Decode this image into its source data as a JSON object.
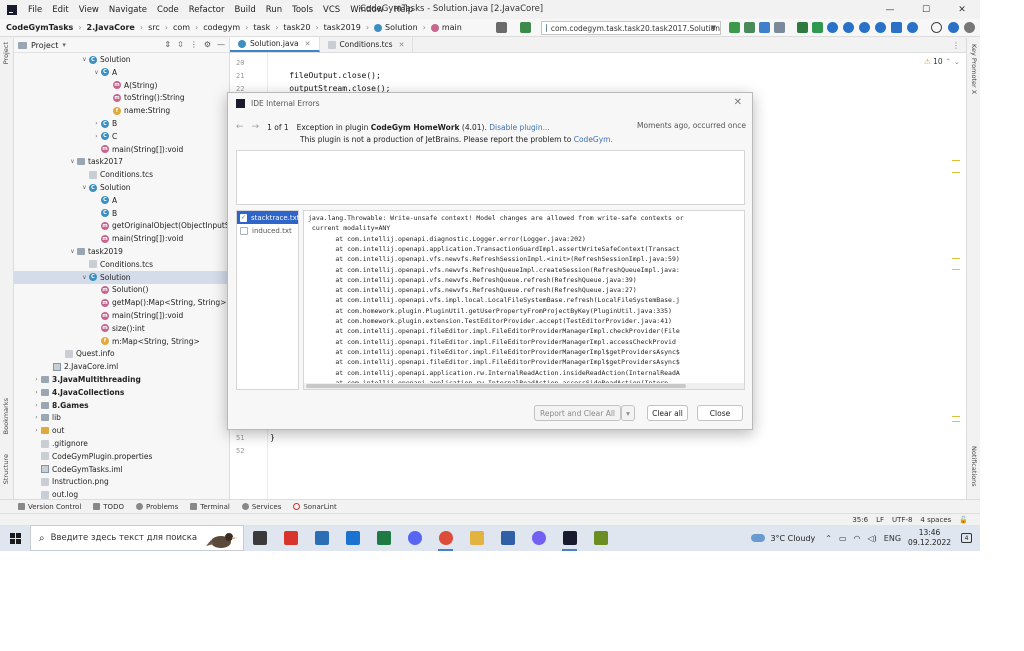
{
  "window": {
    "title": "CodeGymTasks - Solution.java [2.JavaCore]",
    "menu": [
      "File",
      "Edit",
      "View",
      "Navigate",
      "Code",
      "Refactor",
      "Build",
      "Run",
      "Tools",
      "VCS",
      "Window",
      "Help"
    ],
    "controls": [
      "—",
      "☐",
      "✕"
    ]
  },
  "breadcrumbs": [
    "CodeGymTasks",
    "2.JavaCore",
    "src",
    "com",
    "codegym",
    "task",
    "task20",
    "task2019",
    "Solution",
    "main"
  ],
  "run_config": "com.codegym.task.task20.task2017.Solution",
  "project_panel": {
    "title": "Project",
    "tree": [
      {
        "label": "Solution",
        "icon": "class",
        "arrow": "▾",
        "indent": 6
      },
      {
        "label": "A",
        "icon": "class",
        "arrow": "▾",
        "indent": 7
      },
      {
        "label": "A(String)",
        "icon": "method",
        "arrow": "",
        "indent": 8
      },
      {
        "label": "toString():String",
        "icon": "method",
        "arrow": "",
        "indent": 8
      },
      {
        "label": "name:String",
        "icon": "field",
        "arrow": "",
        "indent": 8
      },
      {
        "label": "B",
        "icon": "class",
        "arrow": "▸",
        "indent": 7
      },
      {
        "label": "C",
        "icon": "class",
        "arrow": "▸",
        "indent": 7
      },
      {
        "label": "main(String[]):void",
        "icon": "method",
        "arrow": "",
        "indent": 7
      },
      {
        "label": "task2017",
        "icon": "folder",
        "arrow": "▾",
        "indent": 5
      },
      {
        "label": "Conditions.tcs",
        "icon": "file",
        "arrow": "",
        "indent": 6
      },
      {
        "label": "Solution",
        "icon": "class",
        "arrow": "▾",
        "indent": 6
      },
      {
        "label": "A",
        "icon": "class",
        "arrow": "",
        "indent": 7
      },
      {
        "label": "B",
        "icon": "class",
        "arrow": "",
        "indent": 7
      },
      {
        "label": "getOriginalObject(ObjectInputS",
        "icon": "method",
        "arrow": "",
        "indent": 7
      },
      {
        "label": "main(String[]):void",
        "icon": "method",
        "arrow": "",
        "indent": 7
      },
      {
        "label": "task2019",
        "icon": "folder",
        "arrow": "▾",
        "indent": 5
      },
      {
        "label": "Conditions.tcs",
        "icon": "file",
        "arrow": "",
        "indent": 6
      },
      {
        "label": "Solution",
        "icon": "class",
        "arrow": "▾",
        "indent": 6,
        "selected": true
      },
      {
        "label": "Solution()",
        "icon": "method",
        "arrow": "",
        "indent": 7
      },
      {
        "label": "getMap():Map<String, String>",
        "icon": "method",
        "arrow": "",
        "indent": 7
      },
      {
        "label": "main(String[]):void",
        "icon": "method",
        "arrow": "",
        "indent": 7
      },
      {
        "label": "size():int",
        "icon": "method",
        "arrow": "",
        "indent": 7
      },
      {
        "label": "m:Map<String, String>",
        "icon": "field",
        "arrow": "",
        "indent": 7
      },
      {
        "label": "Quest.info",
        "icon": "file",
        "arrow": "",
        "indent": 4
      },
      {
        "label": "2.JavaCore.iml",
        "icon": "iml",
        "arrow": "",
        "indent": 3
      },
      {
        "label": "3.JavaMultithreading",
        "icon": "folder",
        "arrow": "▸",
        "indent": 2,
        "bold": true
      },
      {
        "label": "4.JavaCollections",
        "icon": "folder",
        "arrow": "▸",
        "indent": 2,
        "bold": true
      },
      {
        "label": "8.Games",
        "icon": "folder",
        "arrow": "▸",
        "indent": 2,
        "bold": true
      },
      {
        "label": "lib",
        "icon": "folder",
        "arrow": "▸",
        "indent": 2
      },
      {
        "label": "out",
        "icon": "folder-orange",
        "arrow": "▸",
        "indent": 2
      },
      {
        "label": ".gitignore",
        "icon": "file",
        "arrow": "",
        "indent": 2
      },
      {
        "label": "CodeGymPlugin.properties",
        "icon": "file",
        "arrow": "",
        "indent": 2
      },
      {
        "label": "CodeGymTasks.iml",
        "icon": "iml",
        "arrow": "",
        "indent": 2
      },
      {
        "label": "Instruction.png",
        "icon": "file",
        "arrow": "",
        "indent": 2
      },
      {
        "label": "out.log",
        "icon": "file",
        "arrow": "",
        "indent": 2
      }
    ]
  },
  "editor": {
    "tabs": [
      {
        "label": "Solution.java",
        "active": true
      },
      {
        "label": "Conditions.tcs",
        "active": false
      }
    ],
    "warnings": "10",
    "lines_top": [
      {
        "num": "20",
        "code": ""
      },
      {
        "num": "21",
        "code": "    fileOutput.close();"
      },
      {
        "num": "22",
        "code": "    outputStream.close();"
      }
    ],
    "lines_bottom": [
      {
        "num": "51",
        "code": "}"
      },
      {
        "num": "52",
        "code": ""
      }
    ]
  },
  "dialog": {
    "title": "IDE Internal Errors",
    "counter": "1 of 1",
    "exception_prefix": "Exception in plugin",
    "plugin_name": "CodeGym HomeWork",
    "plugin_version": "(4.01).",
    "disable_link": "Disable plugin...",
    "time": "Moments ago, occurred once",
    "notice_text": "This plugin is not a production of JetBrains. Please report the problem to",
    "notice_link": "CodeGym.",
    "attachments": [
      {
        "label": "stacktrace.txt",
        "checked": true
      },
      {
        "label": "induced.txt",
        "checked": false
      }
    ],
    "stacktrace": [
      "java.lang.Throwable: Write-unsafe context! Model changes are allowed from write-safe contexts or",
      " current modality=ANY",
      "       at com.intellij.openapi.diagnostic.Logger.error(Logger.java:202)",
      "       at com.intellij.openapi.application.TransactionGuardImpl.assertWriteSafeContext(Transact",
      "       at com.intellij.openapi.vfs.newvfs.RefreshSessionImpl.<init>(RefreshSessionImpl.java:59)",
      "       at com.intellij.openapi.vfs.newvfs.RefreshQueueImpl.createSession(RefreshQueueImpl.java:",
      "       at com.intellij.openapi.vfs.newvfs.RefreshQueue.refresh(RefreshQueue.java:39)",
      "       at com.intellij.openapi.vfs.newvfs.RefreshQueue.refresh(RefreshQueue.java:27)",
      "       at com.intellij.openapi.vfs.impl.local.LocalFileSystemBase.refresh(LocalFileSystemBase.j",
      "       at com.homework.plugin.PluginUtil.getUserPropertyFromProjectByKey(PluginUtil.java:335)",
      "       at com.homework.plugin.extension.TestEditorProvider.accept(TestEditorProvider.java:41)",
      "       at com.intellij.openapi.fileEditor.impl.FileEditorProviderManagerImpl.checkProvider(File",
      "       at com.intellij.openapi.fileEditor.impl.FileEditorProviderManagerImpl.accessCheckProvid",
      "       at com.intellij.openapi.fileEditor.impl.FileEditorProviderManagerImpl$getProvidersAsync$",
      "       at com.intellij.openapi.fileEditor.impl.FileEditorProviderManagerImpl$getProvidersAsync$",
      "       at com.intellij.openapi.application.rw.InternalReadAction.insideReadAction(InternalReadA",
      "       at com.intellij.openapi.application.rw.InternalReadAction.accessSideReadAction(Intern"
    ],
    "buttons": {
      "report": "Report and Clear All",
      "dropdown": "▾",
      "clear": "Clear all",
      "close": "Close"
    }
  },
  "left_strip": [
    "Project",
    "Bookmarks",
    "Structure"
  ],
  "right_strip": [
    "Key Promoter X",
    "Notifications"
  ],
  "tool_windows": [
    "Version Control",
    "TODO",
    "Problems",
    "Terminal",
    "Services",
    "SonarLint"
  ],
  "status_bar": [
    "35:6",
    "LF",
    "UTF-8",
    "4 spaces"
  ],
  "taskbar": {
    "search_placeholder": "Введите здесь текст для поиска",
    "weather": "3°C  Cloudy",
    "lang": "ENG",
    "time": "13:46",
    "date": "09.12.2022",
    "notifications": "4",
    "app_colors": [
      "#3a3a3a",
      "#d9342b",
      "#2a6fb5",
      "#1b73d1",
      "#1f7a44",
      "#5865f2",
      "#dd4b39",
      "#e3b341",
      "#2e5fa7",
      "#7360f2",
      "#1a1a2e",
      "#6b8e23"
    ]
  },
  "colors": {
    "accent": "#4083c9",
    "link": "#3d72b4",
    "selection": "#2f65ca",
    "class_icon": "#3d8fbf",
    "method_icon": "#c7658f",
    "field_icon": "#e0a93e"
  }
}
